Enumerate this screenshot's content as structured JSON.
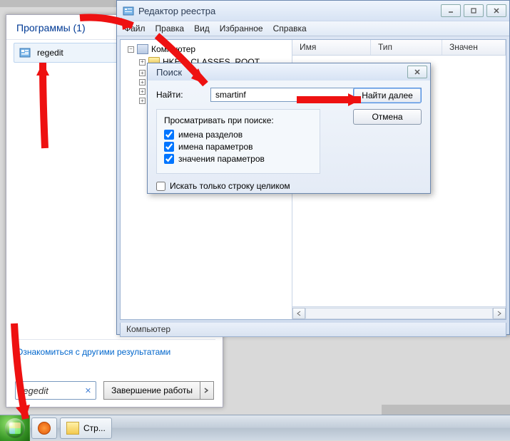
{
  "start": {
    "header": "Программы (1)",
    "item_label": "regedit",
    "more_results": "Ознакомиться с другими результатами",
    "search_value": "regedit",
    "shutdown_label": "Завершение работы"
  },
  "reg": {
    "title": "Редактор реестра",
    "menu": {
      "file": "Файл",
      "edit": "Правка",
      "view": "Вид",
      "fav": "Избранное",
      "help": "Справка"
    },
    "tree": {
      "root": "Компьютер",
      "node1": "HKEY_CLASSES_ROOT"
    },
    "cols": {
      "name": "Имя",
      "type": "Тип",
      "value": "Значен"
    },
    "status": "Компьютер"
  },
  "find": {
    "title": "Поиск",
    "label_find": "Найти:",
    "value": "smartinf",
    "group_title": "Просматривать при поиске:",
    "chk_keys": "имена разделов",
    "chk_values": "имена параметров",
    "chk_data": "значения параметров",
    "chk_whole": "Искать только строку целиком",
    "btn_next": "Найти далее",
    "btn_cancel": "Отмена"
  },
  "taskbar": {
    "btn_explorer": "Стр..."
  }
}
